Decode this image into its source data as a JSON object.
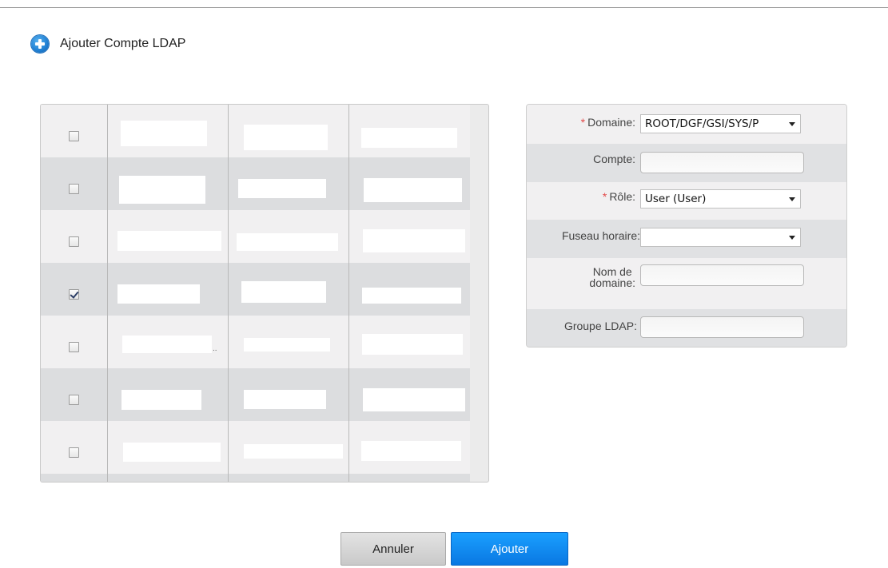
{
  "header": {
    "title": "Ajouter Compte LDAP"
  },
  "grid": {
    "rows": [
      {
        "checked": false
      },
      {
        "checked": false
      },
      {
        "checked": false
      },
      {
        "checked": true
      },
      {
        "checked": false
      },
      {
        "checked": false
      },
      {
        "checked": false
      }
    ],
    "truncation_marker": ".."
  },
  "form": {
    "domain": {
      "label": "Domaine:",
      "required_mark": "*",
      "value": "ROOT/DGF/GSI/SYS/P"
    },
    "account": {
      "label": "Compte:",
      "value": ""
    },
    "role": {
      "label": "Rôle:",
      "required_mark": "*",
      "value": "User (User)"
    },
    "timezone": {
      "label": "Fuseau horaire:",
      "value": ""
    },
    "domain_name": {
      "label_line1": "Nom de",
      "label_line2": "domaine:",
      "value": ""
    },
    "ldap_group": {
      "label": "Groupe LDAP:",
      "value": ""
    }
  },
  "buttons": {
    "cancel": "Annuler",
    "add": "Ajouter"
  },
  "colors": {
    "primary_button": "#0a78e2",
    "required": "#e24a4a"
  }
}
